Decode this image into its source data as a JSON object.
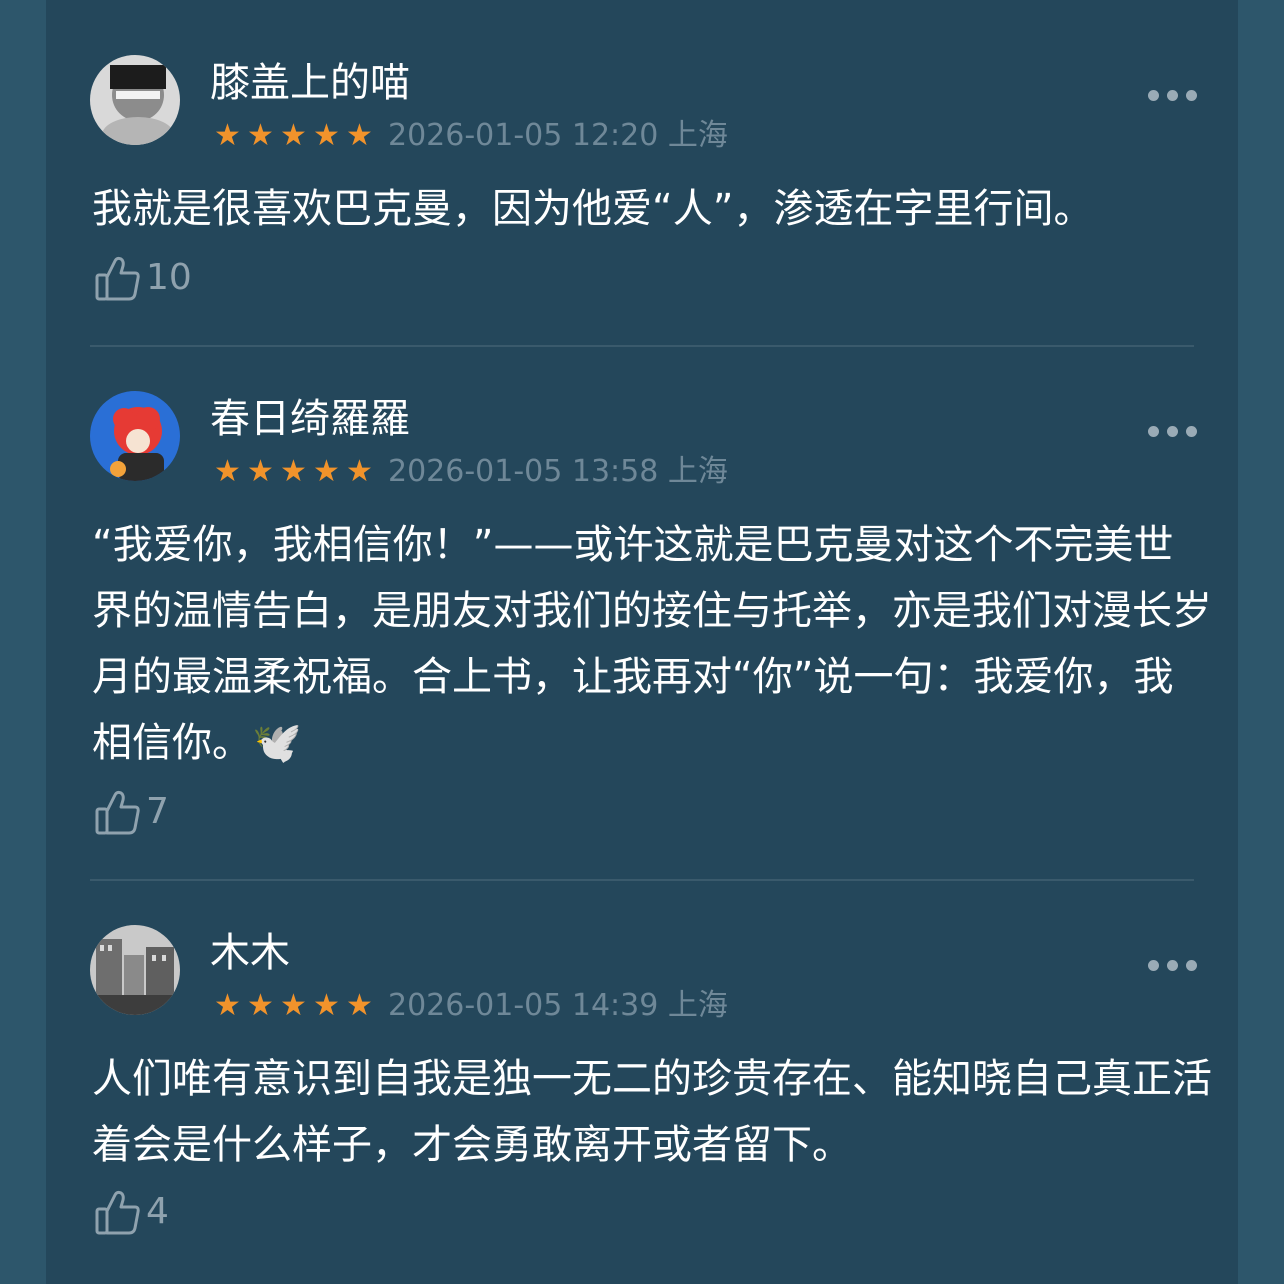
{
  "comments": [
    {
      "username": "膝盖上的喵",
      "meta": "2026-01-05 12:20 上海",
      "rating": 5,
      "body": "我就是很喜欢巴克曼，因为他爱“人”，渗透在字里行间。",
      "likes": "10"
    },
    {
      "username": "春日绮羅羅",
      "meta": "2026-01-05 13:58 上海",
      "rating": 5,
      "body": "“我爱你，我相信你！”——或许这就是巴克曼对这个不完美世界的温情告白，是朋友对我们的接住与托举，亦是我们对漫长岁月的最温柔祝福。合上书，让我再对“你”说一句：我爱你，我相信你。🕊️",
      "likes": "7"
    },
    {
      "username": "木木",
      "meta": "2026-01-05 14:39 上海",
      "rating": 5,
      "body": "人们唯有意识到自我是独一无二的珍贵存在、能知晓自己真正活着会是什么样子，才会勇敢离开或者留下。",
      "likes": "4"
    }
  ],
  "colors": {
    "background": "#2d566b",
    "panel": "#24475b",
    "star": "#f1932b",
    "meta_text": "#6f8898",
    "body_text": "#ffffff"
  },
  "icons": {
    "star": "star-icon",
    "more": "more-options-icon",
    "like": "thumbs-up-icon"
  }
}
